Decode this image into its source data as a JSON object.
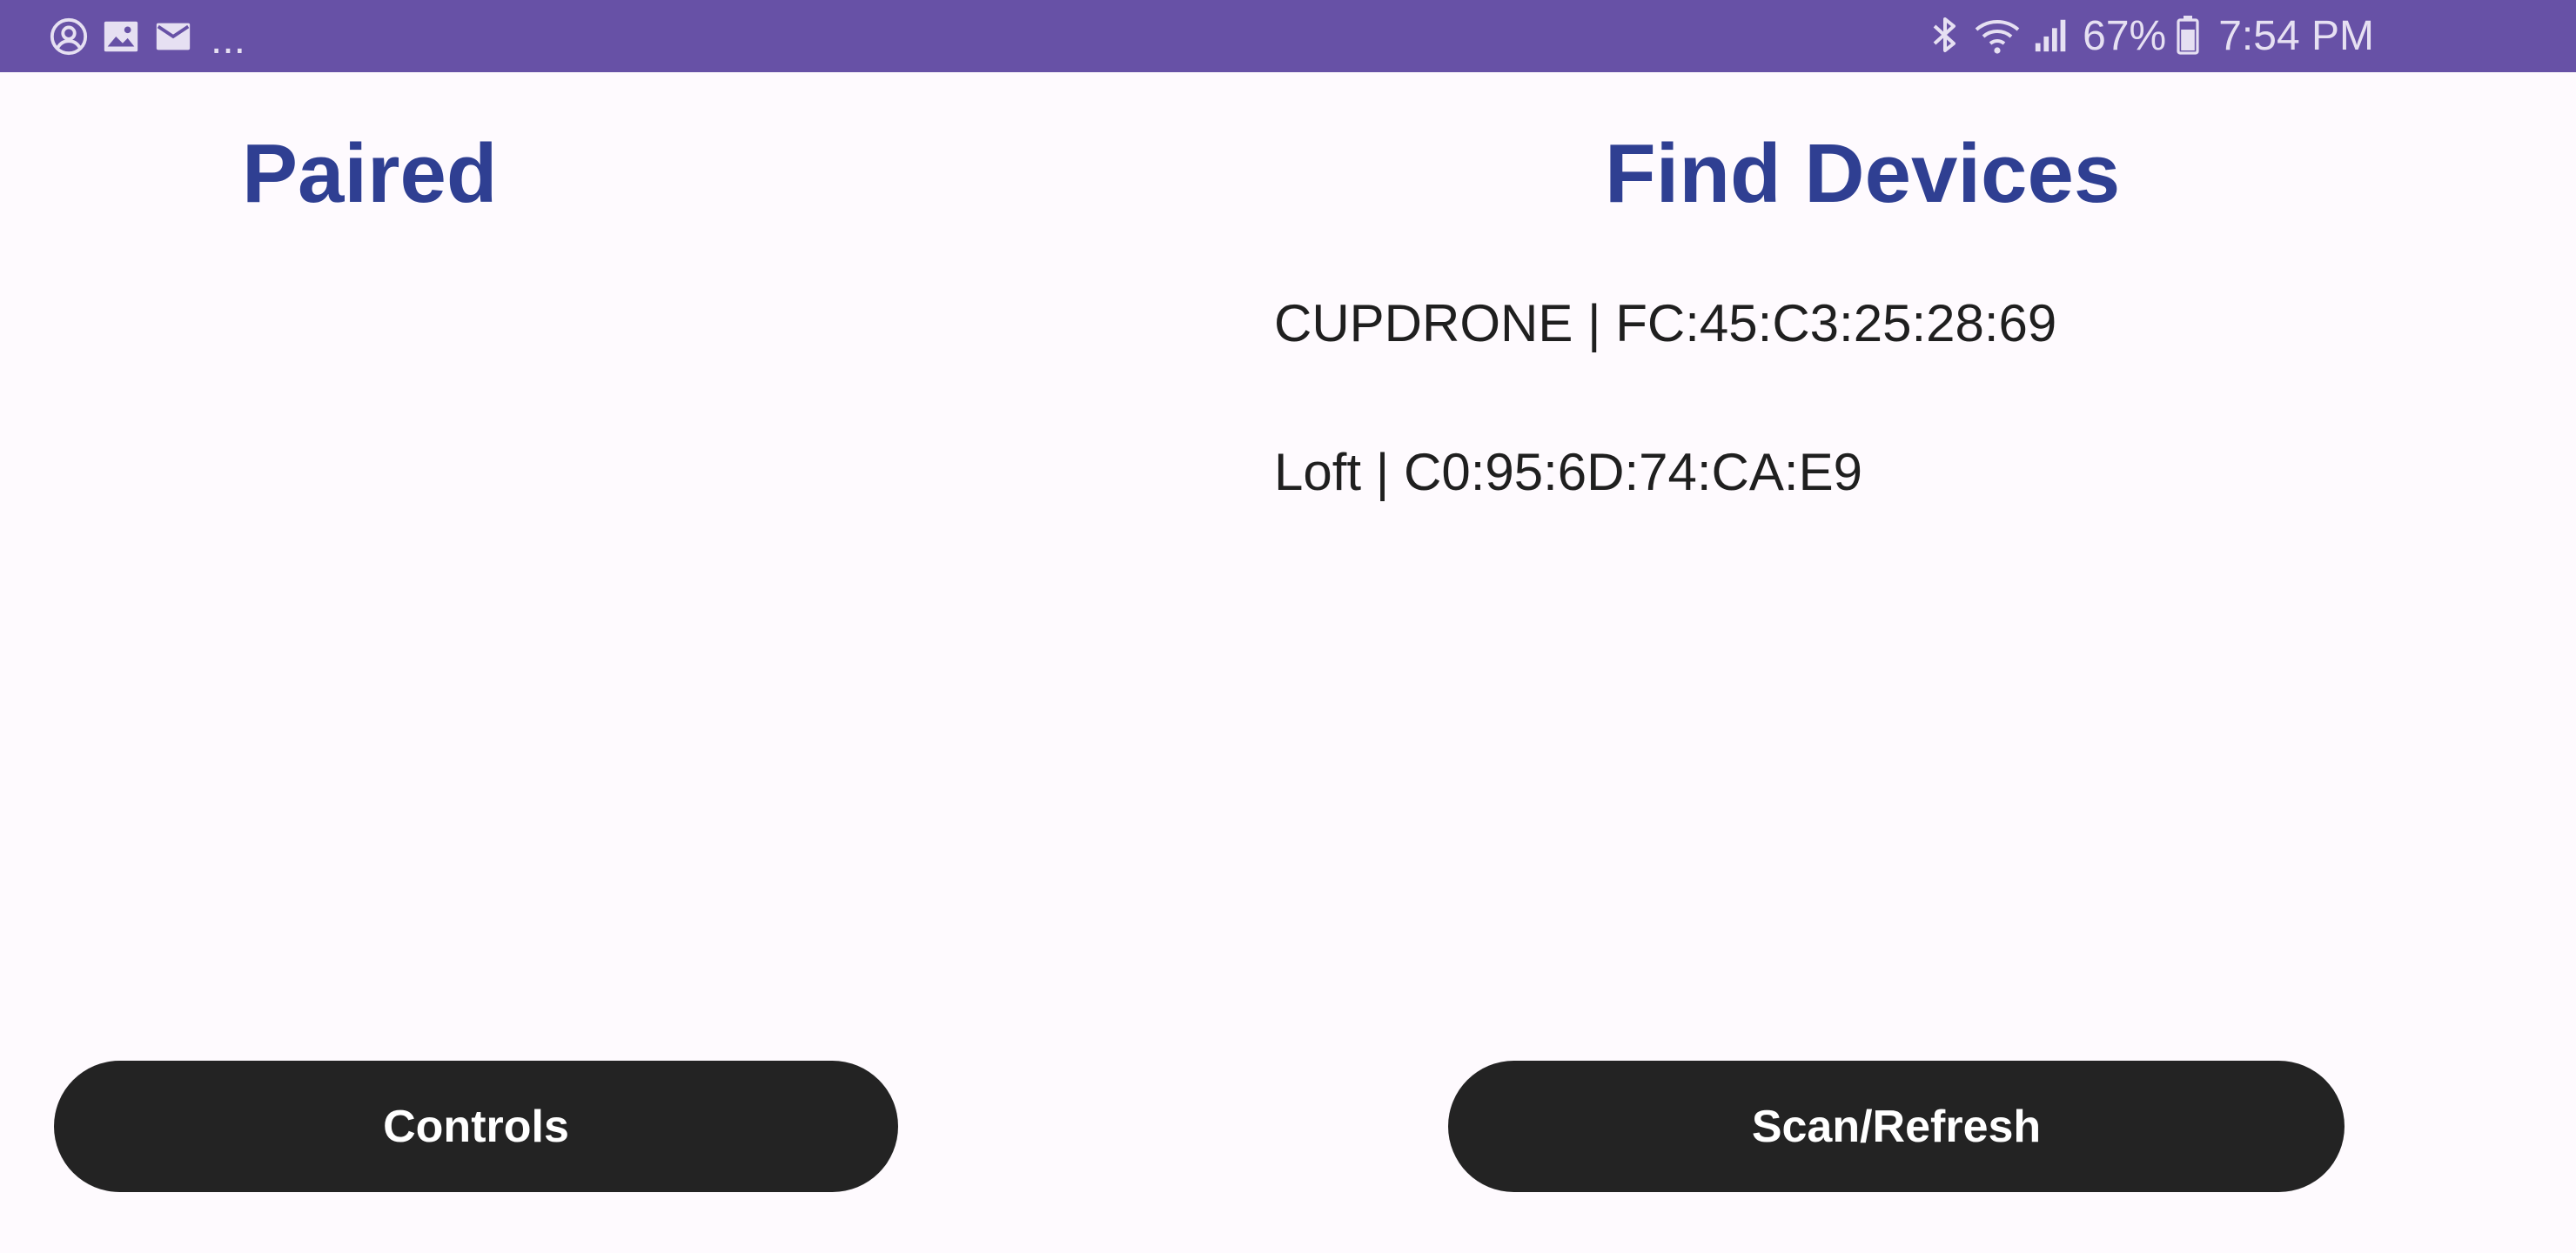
{
  "status_bar": {
    "left_icons": [
      "account-circle-icon",
      "image-icon",
      "mail-icon"
    ],
    "more": "...",
    "right_icons": [
      "bluetooth-icon",
      "wifi-icon",
      "cellular-signal-icon",
      "battery-icon"
    ],
    "battery": "67%",
    "time": "7:54 PM"
  },
  "paired": {
    "title": "Paired"
  },
  "find_devices": {
    "title": "Find Devices",
    "devices": [
      {
        "label": "CUPDRONE | FC:45:C3:25:28:69"
      },
      {
        "label": "Loft | C0:95:6D:74:CA:E9"
      }
    ]
  },
  "buttons": {
    "controls": "Controls",
    "scan_refresh": "Scan/Refresh"
  },
  "colors": {
    "status_bar": "#6751a6",
    "title": "#2f3f92",
    "background": "#fefafe",
    "button": "#232323"
  }
}
